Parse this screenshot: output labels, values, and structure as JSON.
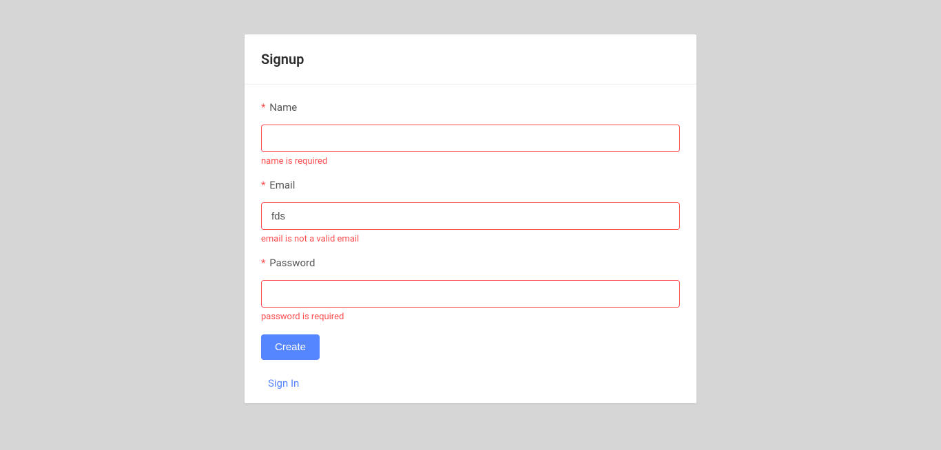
{
  "card": {
    "title": "Signup"
  },
  "form": {
    "name": {
      "label": "Name",
      "value": "",
      "error": "name is required",
      "required_star": "*"
    },
    "email": {
      "label": "Email",
      "value": "fds",
      "error": "email is not a valid email",
      "required_star": "*"
    },
    "password": {
      "label": "Password",
      "value": "",
      "error": "password is required",
      "required_star": "*"
    },
    "submit_label": "Create",
    "signin_link_label": "Sign In"
  }
}
